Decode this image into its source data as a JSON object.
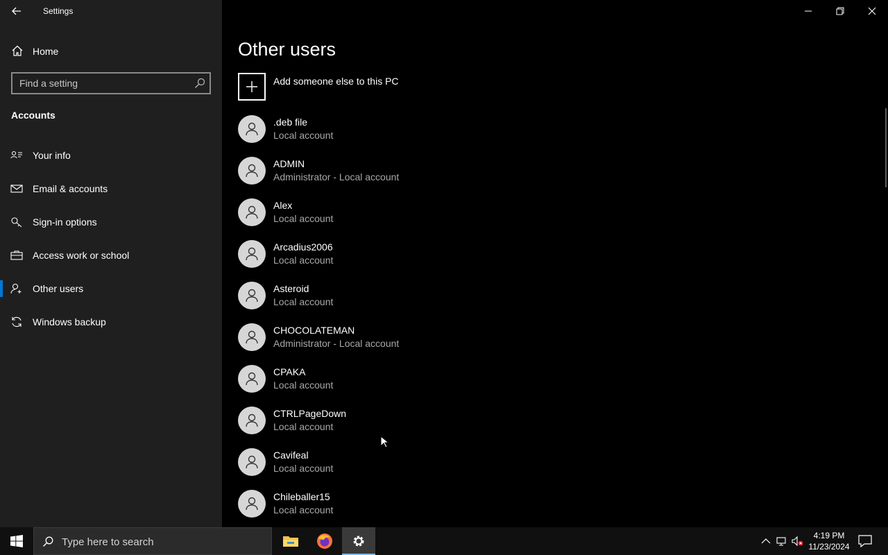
{
  "app": {
    "title": "Settings"
  },
  "sidebar": {
    "home_label": "Home",
    "search_placeholder": "Find a setting",
    "section_title": "Accounts",
    "items": [
      {
        "label": "Your info",
        "icon": "contact-card-icon",
        "active": false
      },
      {
        "label": "Email & accounts",
        "icon": "mail-icon",
        "active": false
      },
      {
        "label": "Sign-in options",
        "icon": "key-icon",
        "active": false
      },
      {
        "label": "Access work or school",
        "icon": "briefcase-icon",
        "active": false
      },
      {
        "label": "Other users",
        "icon": "add-person-icon",
        "active": true
      },
      {
        "label": "Windows backup",
        "icon": "sync-icon",
        "active": false
      }
    ],
    "accent_color": "#0078d7"
  },
  "main": {
    "page_title": "Other users",
    "add_label": "Add someone else to this PC",
    "users": [
      {
        "name": ".deb file",
        "type": "Local account"
      },
      {
        "name": "ADMIN",
        "type": "Administrator - Local account"
      },
      {
        "name": "Alex",
        "type": "Local account"
      },
      {
        "name": "Arcadius2006",
        "type": "Local account"
      },
      {
        "name": "Asteroid",
        "type": "Local account"
      },
      {
        "name": "CHOCOLATEMAN",
        "type": "Administrator - Local account"
      },
      {
        "name": "CPAKA",
        "type": "Local account"
      },
      {
        "name": "CTRLPageDown",
        "type": "Local account"
      },
      {
        "name": "Cavifeal",
        "type": "Local account"
      },
      {
        "name": "Chileballer15",
        "type": "Local account"
      }
    ]
  },
  "taskbar": {
    "search_placeholder": "Type here to search",
    "apps": [
      "file-explorer-icon",
      "firefox-icon",
      "settings-gear-icon"
    ],
    "time": "4:19 PM",
    "date": "11/23/2024"
  }
}
